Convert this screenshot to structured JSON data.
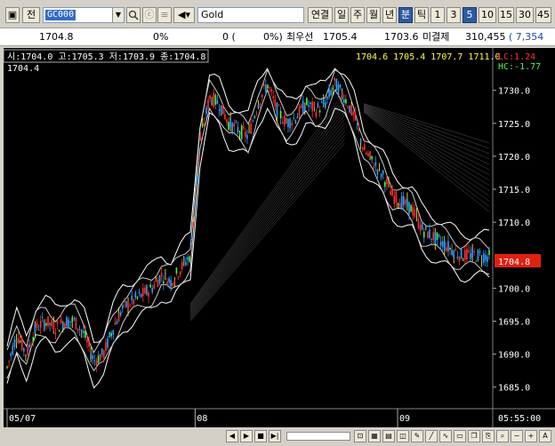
{
  "toolbar": {
    "jeon_label": "전",
    "code_value": "GC000",
    "name_value": "Gold",
    "periods": [
      "연결",
      "일",
      "주",
      "월",
      "년",
      "분",
      "틱",
      "1",
      "3",
      "5",
      "10",
      "15",
      "30",
      "45"
    ],
    "active_period": "5"
  },
  "quote": {
    "price": "1704.8",
    "change_pct": "0%",
    "volume": "0 (",
    "volume_pct": "0%)",
    "best_label": "최우선",
    "ask": "1705.4",
    "bid": "1703.6",
    "oi_label": "미결제",
    "open_interest": "310,455",
    "oi_change": "( 7,354"
  },
  "chart": {
    "ohlc_header": "시:1704.0 고:1705.3 저:1703.9 종:1704.8",
    "last_value": "1704.4",
    "extra_values": "1704.6 1705.4  1707.7 1711.0",
    "lc_label": "LC:1.24",
    "hc_label": "HC:-1.77",
    "price_tag": "1704.8",
    "time_tag": "05:55:00"
  },
  "chart_data": {
    "type": "line",
    "title": "",
    "y_ticks": [
      1730.0,
      1725.0,
      1720.0,
      1715.0,
      1710.0,
      1700.0,
      1695.0,
      1690.0,
      1685.0
    ],
    "y_tick_labels": [
      "1730.0",
      "1725.0",
      "1720.0",
      "1715.0",
      "1710.0",
      "1700.0",
      "1695.0",
      "1690.0",
      "1685.0"
    ],
    "ylim": [
      1682,
      1734
    ],
    "x_tick_labels": [
      "05/07",
      "08",
      "09"
    ],
    "x_tick_positions": [
      0,
      39,
      81
    ],
    "grid": false,
    "last_price": 1704.8,
    "x": [
      0,
      2,
      4,
      6,
      8,
      10,
      12,
      14,
      16,
      18,
      20,
      22,
      24,
      26,
      28,
      30,
      32,
      34,
      36,
      38,
      40,
      42,
      44,
      46,
      48,
      50,
      52,
      54,
      56,
      58,
      60,
      62,
      64,
      66,
      68,
      70,
      72,
      74,
      76,
      78,
      80,
      82,
      84,
      86,
      88,
      90,
      92,
      94,
      96,
      98,
      100
    ],
    "series": [
      {
        "values": [
          1688,
          1693,
          1690,
          1694,
          1695,
          1694,
          1695,
          1695,
          1693,
          1689,
          1690,
          1694,
          1697,
          1698,
          1699,
          1700,
          1702,
          1701,
          1703,
          1705,
          1722,
          1729,
          1728,
          1725,
          1724,
          1723,
          1728,
          1731,
          1727,
          1725,
          1726,
          1728,
          1727,
          1728,
          1731,
          1729,
          1726,
          1721,
          1719,
          1717,
          1714,
          1713,
          1712,
          1709,
          1708,
          1707,
          1706,
          1705,
          1705,
          1705,
          1704.8
        ]
      }
    ]
  }
}
